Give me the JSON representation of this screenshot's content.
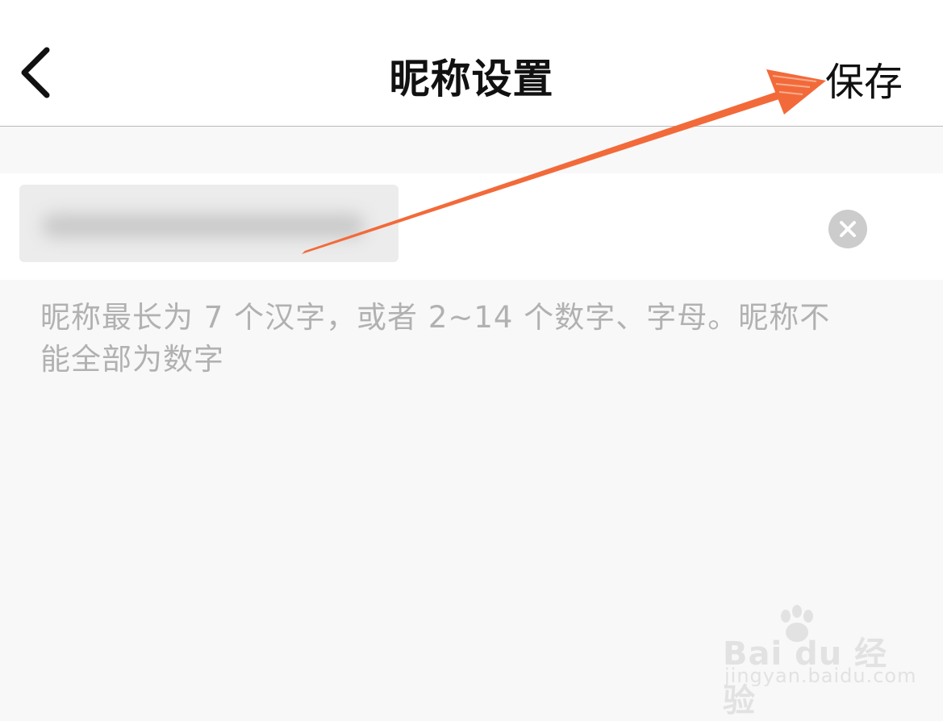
{
  "header": {
    "title": "昵称设置",
    "save_label": "保存",
    "back_icon": "chevron-left-icon"
  },
  "nickname": {
    "value": "",
    "clear_icon": "clear-icon"
  },
  "hint": {
    "line1": "昵称最长为 7 个汉字，或者 2~14 个数字、字母。昵称不",
    "line2": "能全部为数字"
  },
  "annotation": {
    "arrow_color": "#f26a3a"
  },
  "watermark": {
    "brand": "Bai du 经验",
    "site": "jingyan.baidu.com"
  },
  "colors": {
    "background": "#f8f8f8",
    "hint_text": "#b1b1b1",
    "clear_button": "#cccccc"
  }
}
